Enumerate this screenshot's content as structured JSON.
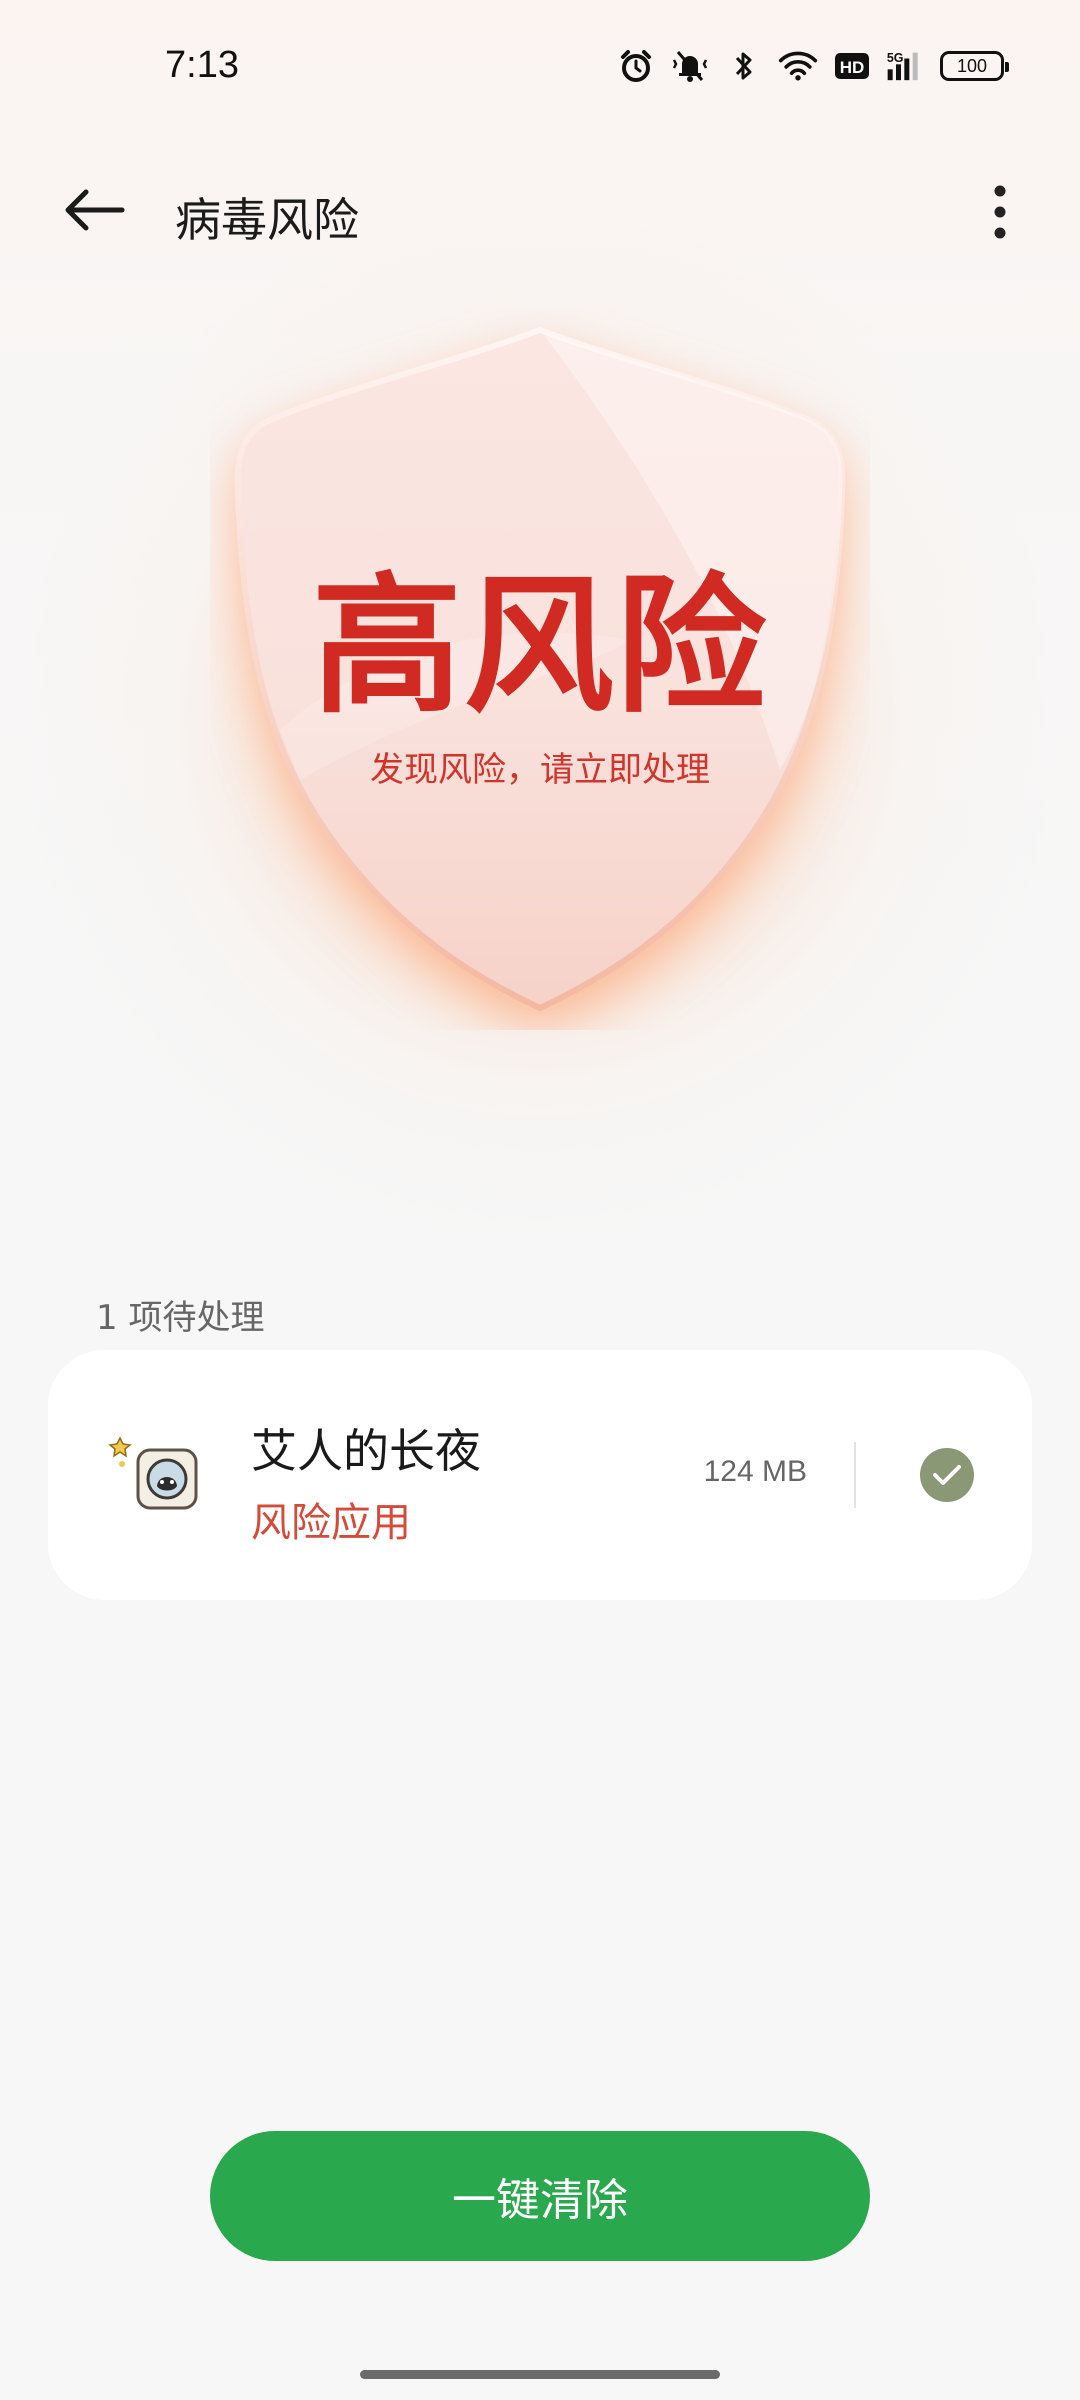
{
  "status_bar": {
    "time": "7:13",
    "battery": "100",
    "icons": [
      "alarm-icon",
      "mute-vibrate-icon",
      "bluetooth-icon",
      "wifi-icon",
      "hd-icon",
      "signal-5g-icon",
      "battery-icon"
    ]
  },
  "header": {
    "title": "病毒风险",
    "back_icon": "arrow-left-icon",
    "more_icon": "more-vertical-icon"
  },
  "risk": {
    "level": "高风险",
    "description": "发现风险，请立即处理",
    "accent_color": "#d02a22"
  },
  "pending": {
    "count_label": "1 项待处理",
    "items": [
      {
        "name": "艾人的长夜",
        "status": "风险应用",
        "size": "124 MB",
        "checked": true
      }
    ]
  },
  "actions": {
    "clean_label": "一键清除",
    "clean_color": "#2aa84d"
  }
}
